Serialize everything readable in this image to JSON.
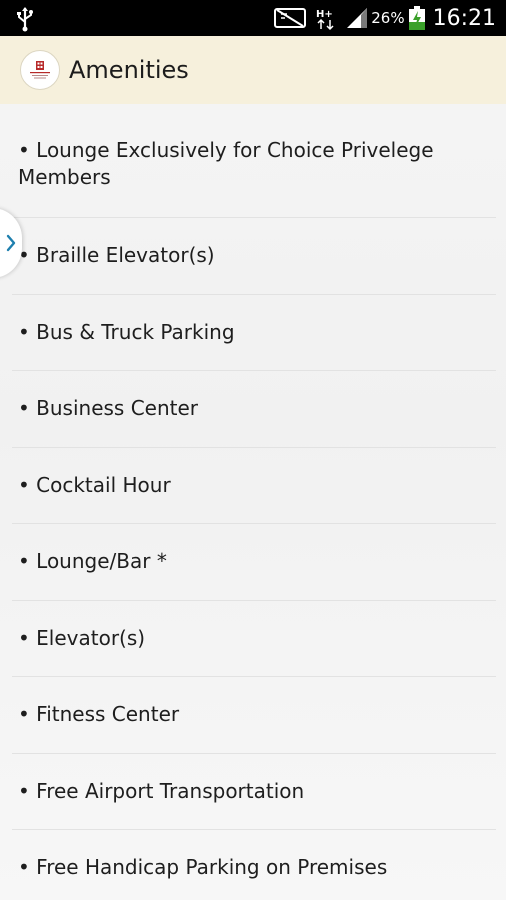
{
  "status_bar": {
    "battery_percent": "26%",
    "time": "16:21",
    "icons": [
      "usb-icon",
      "no-sim-icon",
      "hplus-network-icon",
      "signal-icon",
      "battery-charging-icon"
    ]
  },
  "header": {
    "title": "Amenities",
    "logo": "hotel-logo"
  },
  "drawer_toggle": {
    "icon": "chevron-right-icon"
  },
  "amenities": [
    "• Lounge Exclusively for Choice Privelege Members",
    "• Braille Elevator(s)",
    "• Bus & Truck Parking",
    "• Business Center",
    "• Cocktail Hour",
    "• Lounge/Bar *",
    "• Elevator(s)",
    "• Fitness Center",
    "• Free Airport Transportation",
    "• Free Handicap Parking on Premises"
  ],
  "colors": {
    "header_bg": "#f6f0dc",
    "status_bg": "#000000",
    "charging": "#3aa02a",
    "chevron": "#1e7fae"
  }
}
